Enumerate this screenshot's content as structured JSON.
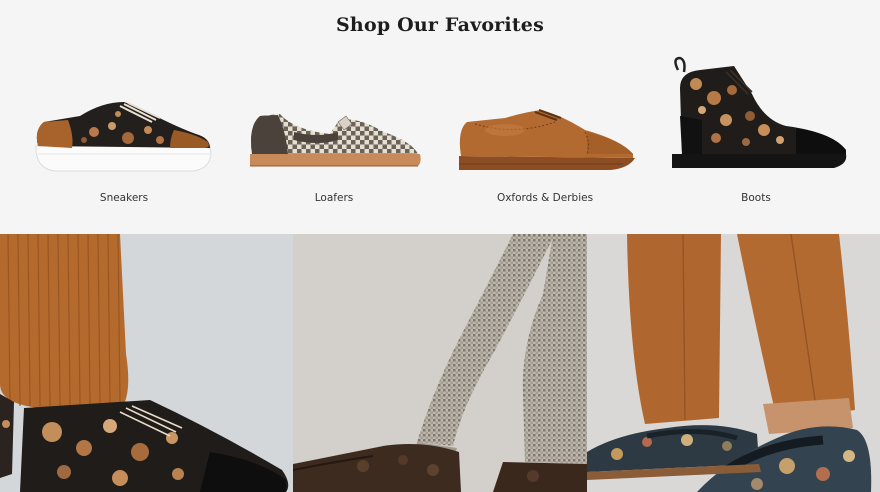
{
  "section_title": "Shop Our Favorites",
  "categories": [
    {
      "label": "Sneakers",
      "icon": "floral-sneaker-image"
    },
    {
      "label": "Loafers",
      "icon": "checkered-loafer-image"
    },
    {
      "label": "Oxfords & Derbies",
      "icon": "brown-oxford-image"
    },
    {
      "label": "Boots",
      "icon": "floral-boot-image"
    }
  ],
  "lifestyle_panels": [
    {
      "icon": "floral-boot-corduroy-photo"
    },
    {
      "icon": "embossed-shoe-houndstooth-photo"
    },
    {
      "icon": "tapestry-loafer-rust-trousers-photo"
    }
  ],
  "colors": {
    "page_background": "#f5f5f5",
    "cognac_leather": "#a8622c",
    "floral_black": "#1f1c1a",
    "rust_trousers": "#b0672f"
  }
}
